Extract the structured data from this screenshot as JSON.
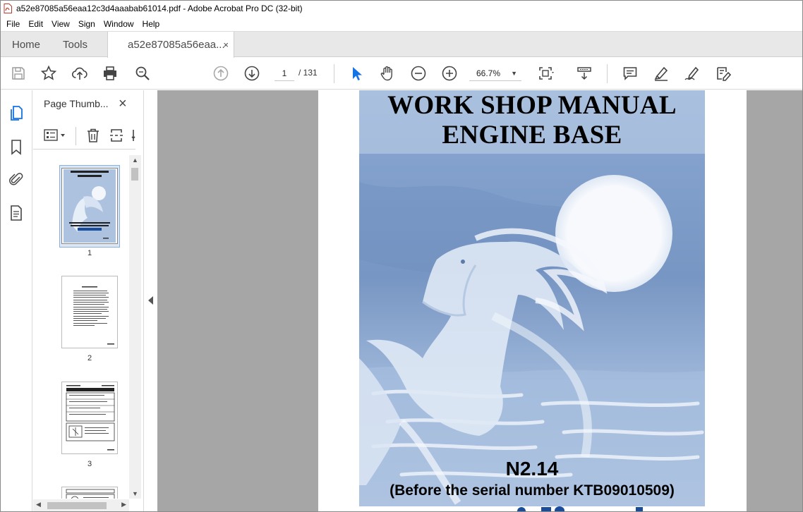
{
  "window": {
    "title": "a52e87085a56eaa12c3d4aaabab61014.pdf - Adobe Acrobat Pro DC (32-bit)"
  },
  "menu": [
    "File",
    "Edit",
    "View",
    "Sign",
    "Window",
    "Help"
  ],
  "tabs": {
    "home": "Home",
    "tools": "Tools",
    "document": "a52e87085a56eaa...",
    "close_glyph": "×"
  },
  "toolbar": {
    "current_page": "1",
    "total_pages": "/ 131",
    "zoom": "66.7%",
    "icons": [
      "save-icon",
      "bookmark-star-icon",
      "upload-icon",
      "print-icon",
      "zoom-search-icon",
      "page-up-icon",
      "page-down-icon",
      "select-cursor-icon",
      "hand-icon",
      "zoom-out-icon",
      "zoom-in-icon",
      "fit-page-icon",
      "scroll-mode-icon",
      "comment-icon",
      "highlight-icon",
      "sign-icon",
      "fill-sign-icon"
    ]
  },
  "sidebar": {
    "panel_title": "Page Thumb...",
    "close_glyph": "×",
    "thumbnails": [
      {
        "label": "1",
        "selected": true
      },
      {
        "label": "2",
        "selected": false
      },
      {
        "label": "3",
        "selected": false
      }
    ]
  },
  "document": {
    "title_line1": "WORK SHOP MANUAL",
    "title_line2": "ENGINE BASE",
    "model": "N2.14",
    "serial_note": "(Before the serial number KTB09010509)"
  },
  "colors": {
    "accent_blue": "#1473e6",
    "tab_bar": "#e8e8e8",
    "doc_background": "#a6a6a6",
    "cover_blue": "#7f9dc7"
  }
}
